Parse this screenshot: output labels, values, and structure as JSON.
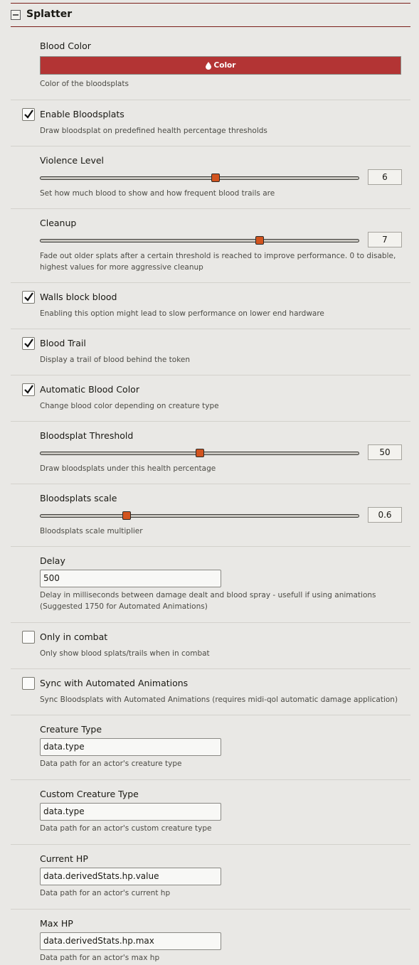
{
  "section": {
    "title": "Splatter"
  },
  "settings": {
    "blood_color": {
      "label": "Blood Color",
      "button_label": "Color",
      "value": "#b33434",
      "hint": "Color of the bloodsplats"
    },
    "enable_bloodsplats": {
      "label": "Enable Bloodsplats",
      "checked": true,
      "hint": "Draw bloodsplat on predefined health percentage thresholds"
    },
    "violence_level": {
      "label": "Violence Level",
      "value": "6",
      "fraction": 0.55,
      "hint": "Set how much blood to show and how frequent blood trails are"
    },
    "cleanup": {
      "label": "Cleanup",
      "value": "7",
      "fraction": 0.69,
      "hint": "Fade out older splats after a certain threshold is reached to improve performance. 0 to disable, highest values for more aggressive cleanup"
    },
    "walls_block_blood": {
      "label": "Walls block blood",
      "checked": true,
      "hint": "Enabling this option might lead to slow performance on lower end hardware"
    },
    "blood_trail": {
      "label": "Blood Trail",
      "checked": true,
      "hint": "Display a trail of blood behind the token"
    },
    "automatic_blood_color": {
      "label": "Automatic Blood Color",
      "checked": true,
      "hint": "Change blood color depending on creature type"
    },
    "bloodsplat_threshold": {
      "label": "Bloodsplat Threshold",
      "value": "50",
      "fraction": 0.5,
      "hint": "Draw bloodsplats under this health percentage"
    },
    "bloodsplats_scale": {
      "label": "Bloodsplats scale",
      "value": "0.6",
      "fraction": 0.27,
      "hint": "Bloodsplats scale multiplier"
    },
    "delay": {
      "label": "Delay",
      "value": "500",
      "hint": "Delay in milliseconds between damage dealt and blood spray - usefull if using animations (Suggested 1750 for Automated Animations)"
    },
    "only_in_combat": {
      "label": "Only in combat",
      "checked": false,
      "hint": "Only show blood splats/trails when in combat"
    },
    "sync_automated_animations": {
      "label": "Sync with Automated Animations",
      "checked": false,
      "hint": "Sync Bloodsplats with Automated Animations (requires midi-qol automatic damage application)"
    },
    "creature_type": {
      "label": "Creature Type",
      "value": "data.type",
      "hint": "Data path for an actor's creature type"
    },
    "custom_creature_type": {
      "label": "Custom Creature Type",
      "value": "data.type",
      "hint": "Data path for an actor's custom creature type"
    },
    "current_hp": {
      "label": "Current HP",
      "value": "data.derivedStats.hp.value",
      "hint": "Data path for an actor's current hp"
    },
    "max_hp": {
      "label": "Max HP",
      "value": "data.derivedStats.hp.max",
      "hint": "Data path for an actor's max hp"
    }
  },
  "icons": {
    "collapse": "minus-square-icon",
    "color_button": "droplet-icon",
    "checkbox": "checkmark-icon"
  }
}
